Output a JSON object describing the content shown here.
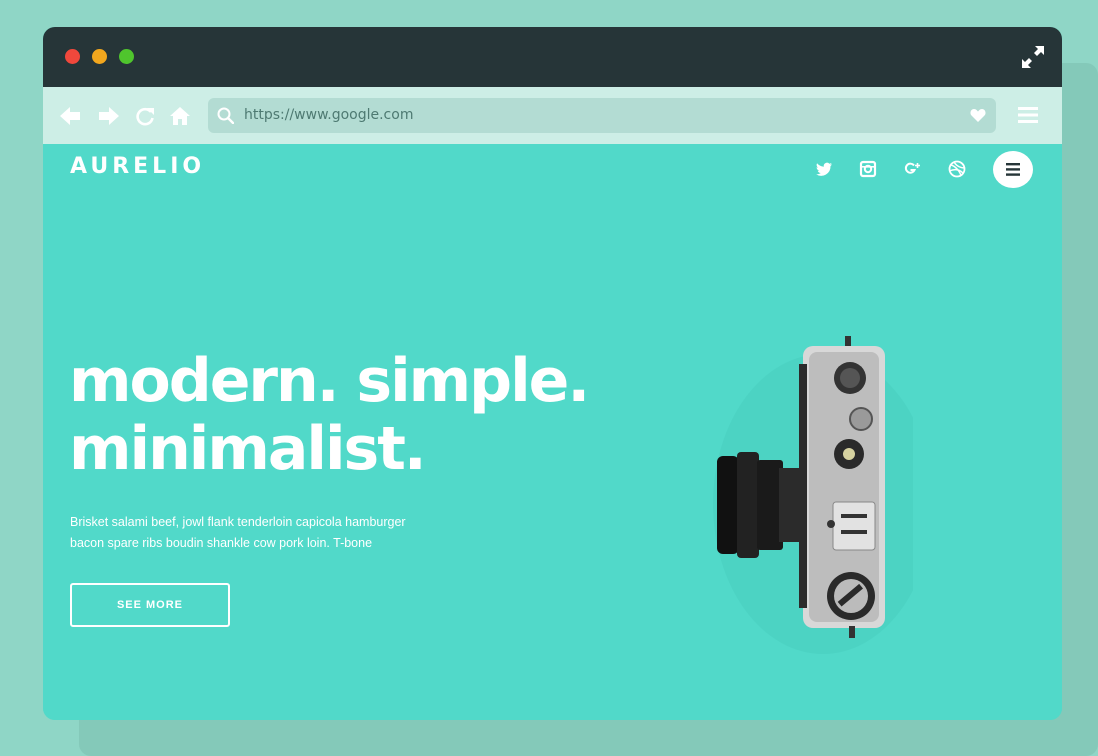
{
  "browser": {
    "address_url": "https://www.google.com",
    "icons": {
      "back": "arrow-left-icon",
      "forward": "arrow-right-icon",
      "reload": "reload-icon",
      "home": "home-icon",
      "search": "search-icon",
      "favorite": "heart-icon",
      "menu": "menu-icon",
      "fullscreen": "fullscreen-icon"
    }
  },
  "site": {
    "logo": "AURELIO",
    "social": [
      "twitter-icon",
      "instagram-icon",
      "google-plus-icon",
      "dribbble-icon"
    ],
    "headline_line1": "modern. simple.",
    "headline_line2": "minimalist.",
    "blurb_line1": "Brisket salami beef, jowl flank tenderloin capicola hamburger",
    "blurb_line2": "bacon spare ribs boudin shankle cow pork loin. T-bone",
    "cta_label": "SEE MORE"
  },
  "colors": {
    "page_background": "#8fd6c6",
    "title_bar": "#263538",
    "toolbar": "#cdeee6",
    "address_bar": "#b3dcd3",
    "hero_background": "#51d9c9",
    "text": "#ffffff"
  }
}
